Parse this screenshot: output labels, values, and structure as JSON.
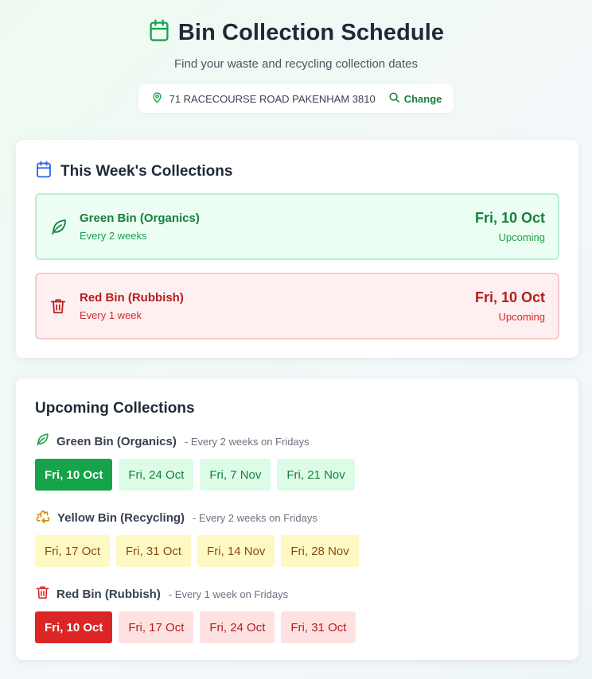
{
  "header": {
    "title": "Bin Collection Schedule",
    "subtitle": "Find your waste and recycling collection dates",
    "address": "71 RACECOURSE ROAD PAKENHAM 3810",
    "change_label": "Change"
  },
  "this_week": {
    "title": "This Week's Collections",
    "items": [
      {
        "name": "Green Bin (Organics)",
        "frequency": "Every 2 weeks",
        "date": "Fri, 10 Oct",
        "status": "Upcoming",
        "icon": "leaf-icon"
      },
      {
        "name": "Red Bin (Rubbish)",
        "frequency": "Every 1 week",
        "date": "Fri, 10 Oct",
        "status": "Upcoming",
        "icon": "trash-icon"
      }
    ]
  },
  "upcoming": {
    "title": "Upcoming Collections",
    "bins": [
      {
        "name": "Green Bin (Organics)",
        "note": "- Every 2 weeks on Fridays",
        "icon": "leaf-icon",
        "color": "#16a34a",
        "dates": [
          "Fri, 10 Oct",
          "Fri, 24 Oct",
          "Fri, 7 Nov",
          "Fri, 21 Nov"
        ]
      },
      {
        "name": "Yellow Bin (Recycling)",
        "note": "- Every 2 weeks on Fridays",
        "icon": "recycle-icon",
        "color": "#ca8a04",
        "dates": [
          "Fri, 17 Oct",
          "Fri, 31 Oct",
          "Fri, 14 Nov",
          "Fri, 28 Nov"
        ]
      },
      {
        "name": "Red Bin (Rubbish)",
        "note": "- Every 1 week on Fridays",
        "icon": "trash-icon",
        "color": "#dc2626",
        "dates": [
          "Fri, 10 Oct",
          "Fri, 17 Oct",
          "Fri, 24 Oct",
          "Fri, 31 Oct"
        ]
      }
    ]
  }
}
